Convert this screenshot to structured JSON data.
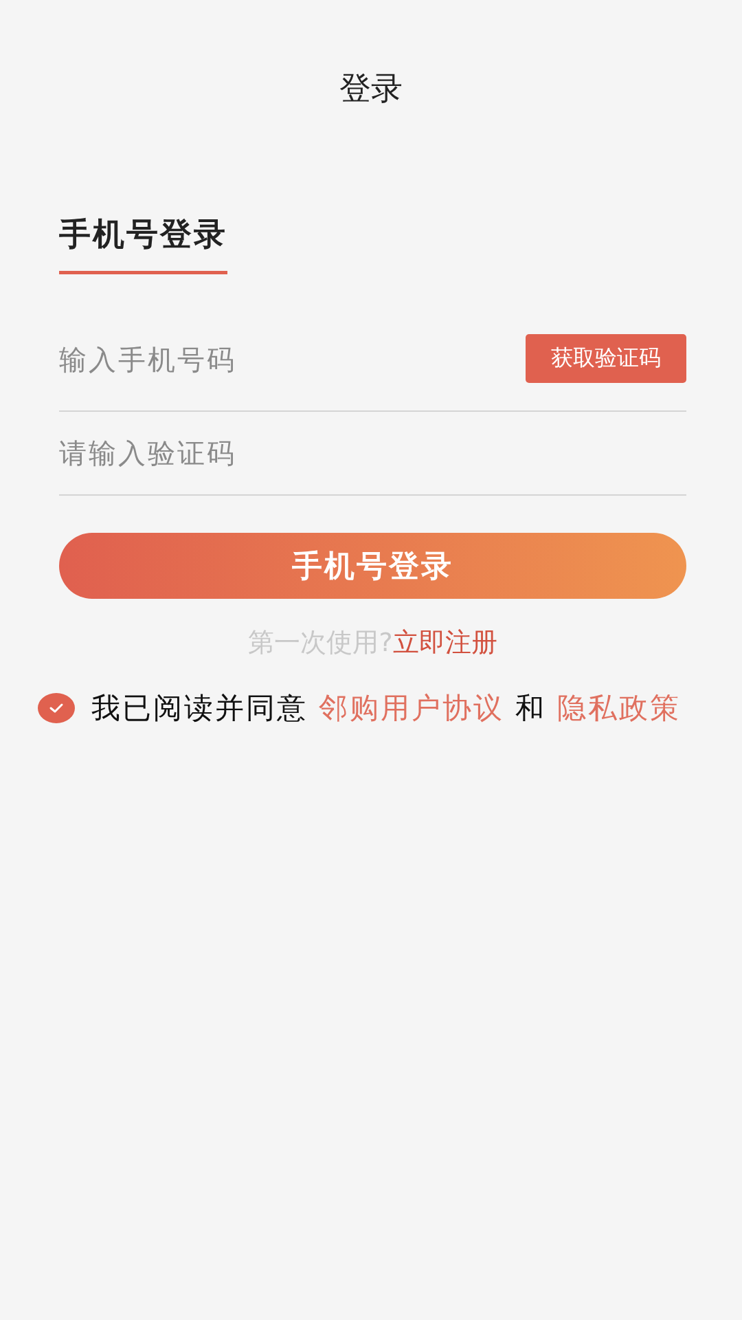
{
  "header": {
    "title": "登录"
  },
  "tabs": [
    {
      "label": "手机号登录",
      "selected": true
    }
  ],
  "phone_field": {
    "placeholder": "输入手机号码"
  },
  "get_code_button": "获取验证码",
  "code_field": {
    "placeholder": "请输入验证码"
  },
  "login_button": "手机号登录",
  "register": {
    "prompt": "第一次使用?",
    "link": "立即注册"
  },
  "agreement": {
    "checked": true,
    "text": "我已阅读并同意",
    "link_1": "邻购用户协议",
    "joiner": "和",
    "link_2": "隐私政策"
  }
}
